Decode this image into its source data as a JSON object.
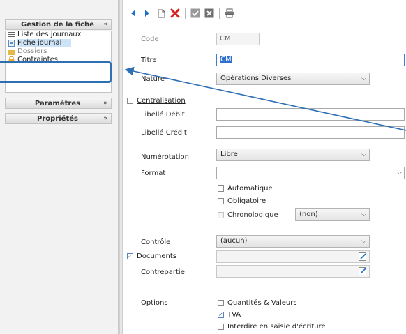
{
  "sidebar": {
    "groups": [
      {
        "label": "Gestion de la fiche",
        "chevron": "«"
      },
      {
        "label": "Paramètres",
        "chevron": "»"
      },
      {
        "label": "Propriétés",
        "chevron": "»"
      }
    ],
    "items": [
      {
        "label": "Liste des journaux",
        "icon": "list-icon"
      },
      {
        "label": "Fiche journal",
        "icon": "document-icon",
        "selected": true
      },
      {
        "label": "Dossiers",
        "icon": "folder-icon"
      },
      {
        "label": "Contraintes",
        "icon": "lock-icon"
      }
    ]
  },
  "toolbar": {
    "buttons": [
      "previous-icon",
      "next-icon",
      "new-document-icon",
      "delete-icon",
      "validate-icon",
      "cancel-icon",
      "print-icon"
    ]
  },
  "form": {
    "code": {
      "label": "Code",
      "value": "CM"
    },
    "titre": {
      "label": "Titre",
      "value": "CM"
    },
    "nature": {
      "label": "Nature",
      "value": "Opérations Diverses"
    },
    "centralisation": {
      "label": "Centralisation",
      "checked": false
    },
    "libelle_debit": {
      "label": "Libellé Débit",
      "value": ""
    },
    "libelle_credit": {
      "label": "Libellé Crédit",
      "value": ""
    },
    "numerotation": {
      "label": "Numérotation",
      "value": "Libre"
    },
    "format": {
      "label": "Format",
      "value": ""
    },
    "automatique": {
      "label": "Automatique",
      "checked": false
    },
    "obligatoire": {
      "label": "Obligatoire",
      "checked": false
    },
    "chronologique": {
      "label": "Chronologique",
      "checked": false,
      "select_value": "(non)"
    },
    "controle": {
      "label": "Contrôle",
      "value": "(aucun)"
    },
    "documents": {
      "label": "Documents",
      "checked": true,
      "value": ""
    },
    "contrepartie": {
      "label": "Contrepartie",
      "value": ""
    },
    "options": {
      "label": "Options",
      "items": [
        {
          "label": "Quantités & Valeurs",
          "checked": false
        },
        {
          "label": "TVA",
          "checked": true
        },
        {
          "label": "Interdire en saisie d'écriture",
          "checked": false
        }
      ]
    }
  },
  "colors": {
    "accent": "#2f6fb4",
    "selection": "#cde3f7",
    "delete_red": "#d9221f",
    "nav_blue": "#1d6fc6"
  }
}
